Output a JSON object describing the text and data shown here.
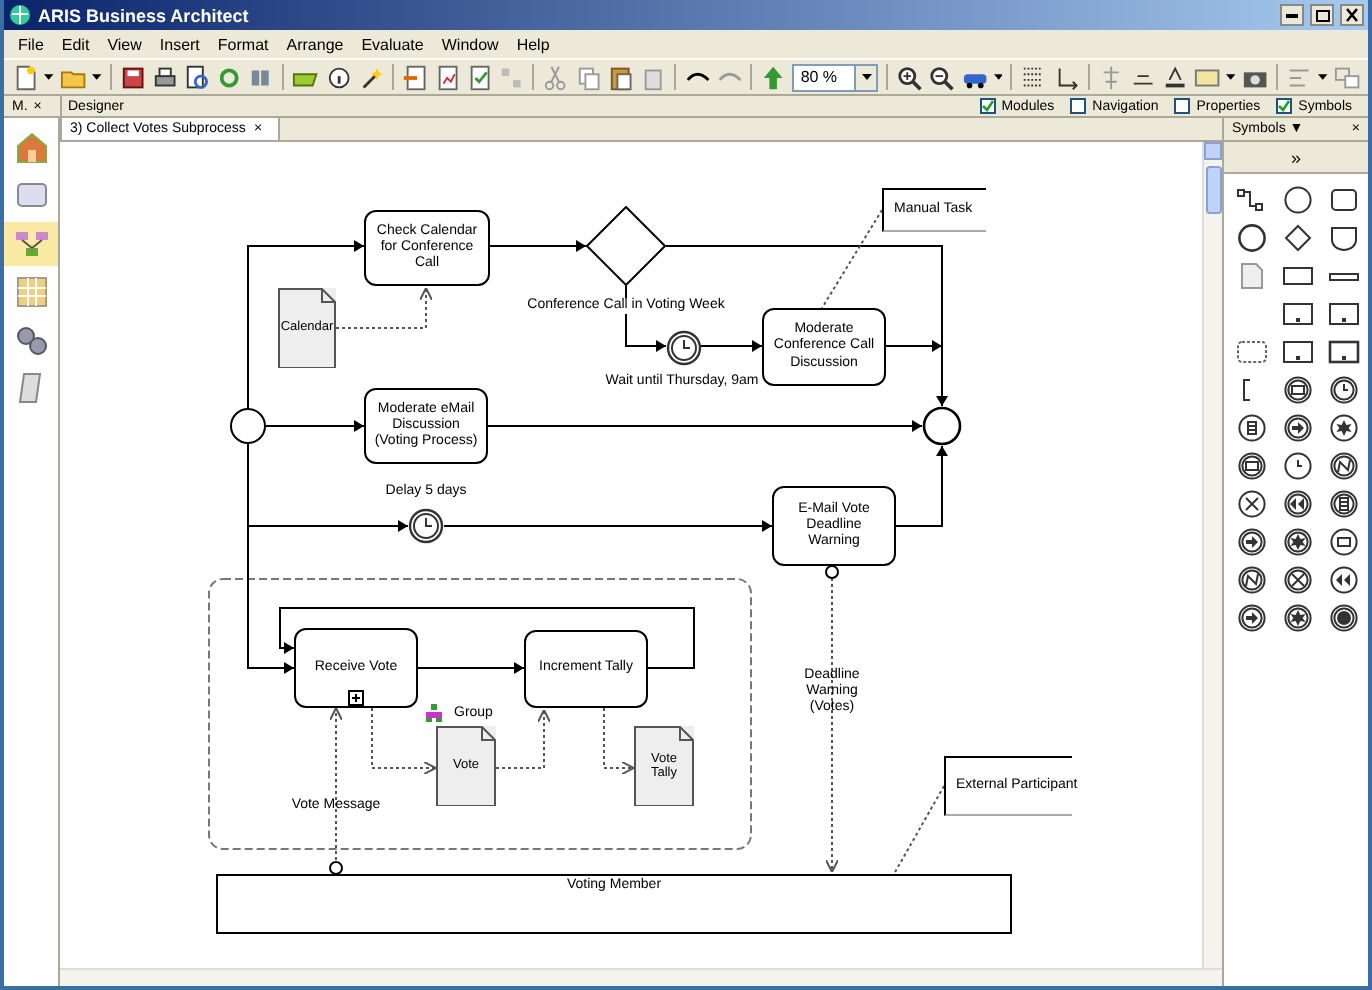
{
  "window": {
    "title": "ARIS Business Architect"
  },
  "menu": [
    "File",
    "Edit",
    "View",
    "Insert",
    "Format",
    "Arrange",
    "Evaluate",
    "Window",
    "Help"
  ],
  "toolbar": {
    "zoom": "80 %"
  },
  "side_tab": {
    "label": "M.",
    "close": "×"
  },
  "designer": {
    "title": "Designer",
    "options": [
      {
        "label": "Modules",
        "checked": true
      },
      {
        "label": "Navigation",
        "checked": false
      },
      {
        "label": "Properties",
        "checked": false
      },
      {
        "label": "Symbols",
        "checked": true
      }
    ]
  },
  "sidebar": {
    "items": [
      {
        "selected": false
      },
      {
        "selected": false
      },
      {
        "selected": true
      },
      {
        "selected": false
      },
      {
        "selected": false
      },
      {
        "selected": false
      }
    ]
  },
  "document_tab": {
    "label": "3) Collect Votes Subprocess",
    "close": "×"
  },
  "diagram": {
    "nodes": [
      {
        "kind": "task",
        "label": "Check Calendar for Conference Call"
      },
      {
        "kind": "document",
        "label": "Calendar"
      },
      {
        "kind": "gateway"
      },
      {
        "kind": "label",
        "label": "Conference Call in Voting Week"
      },
      {
        "kind": "timer"
      },
      {
        "kind": "label",
        "label": "Wait until Thursday, 9am"
      },
      {
        "kind": "task",
        "label": "Moderate Conference Call Discussion"
      },
      {
        "kind": "annotation",
        "label": "Manual Task"
      },
      {
        "kind": "start"
      },
      {
        "kind": "task",
        "label": "Moderate eMail Discussion (Voting Process)"
      },
      {
        "kind": "end"
      },
      {
        "kind": "label",
        "label": "Delay 5 days"
      },
      {
        "kind": "timer"
      },
      {
        "kind": "task",
        "label": "E-Mail Vote Deadline Warning"
      },
      {
        "kind": "group",
        "label": "Group"
      },
      {
        "kind": "subprocess",
        "label": "Receive Vote"
      },
      {
        "kind": "task",
        "label": "Increment Tally"
      },
      {
        "kind": "document",
        "label": "Vote"
      },
      {
        "kind": "document",
        "label": "Vote Tally"
      },
      {
        "kind": "label",
        "label": "Vote Message"
      },
      {
        "kind": "label",
        "label": "Deadline Warning (Votes)"
      },
      {
        "kind": "annotation",
        "label": "External Participant"
      },
      {
        "kind": "pool",
        "label": "Voting Member"
      }
    ]
  },
  "symbols_panel": {
    "title": "Symbols ▼",
    "close": "×",
    "expand": "»"
  }
}
